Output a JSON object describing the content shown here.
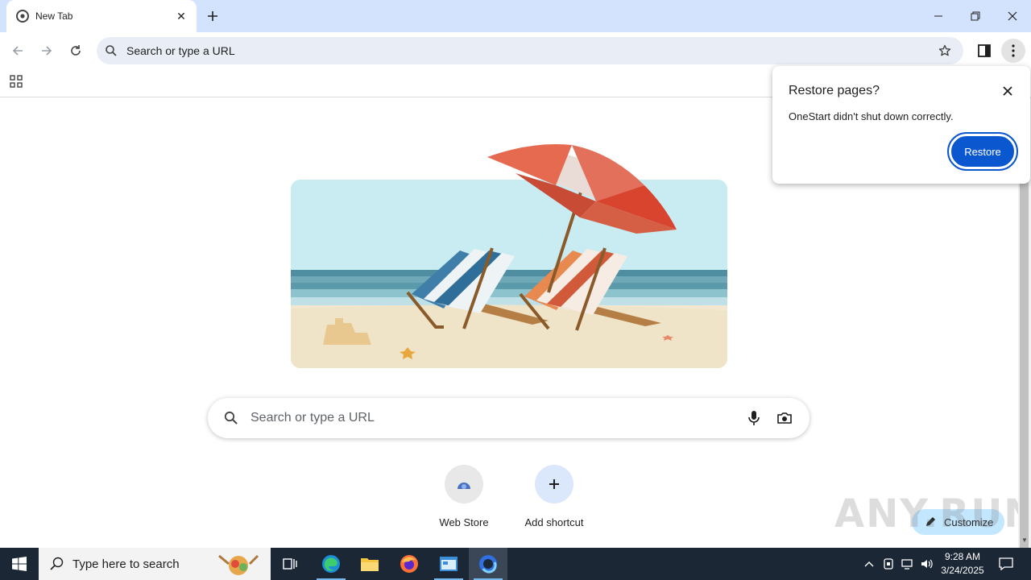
{
  "tab": {
    "title": "New Tab",
    "close_glyph": "✕"
  },
  "toolbar": {
    "omnibox_text": "Search or type a URL"
  },
  "main": {
    "search_placeholder": "Search or type a URL",
    "shortcuts": [
      {
        "label": "Web Store",
        "icon": "web-store-icon"
      },
      {
        "label": "Add shortcut",
        "icon": "plus-icon"
      }
    ],
    "customize_label": "Customize"
  },
  "popup": {
    "title": "Restore pages?",
    "message": "OneStart didn't shut down correctly.",
    "restore_label": "Restore"
  },
  "watermark": "ANY.RUN",
  "taskbar": {
    "search_placeholder": "Type here to search",
    "time": "9:28 AM",
    "date": "3/24/2025"
  },
  "colors": {
    "accent": "#0b57d0",
    "tabstrip": "#d3e3fd",
    "omnibox": "#e9eef6",
    "customize": "#c2e7ff",
    "taskbar": "#1c2736"
  }
}
